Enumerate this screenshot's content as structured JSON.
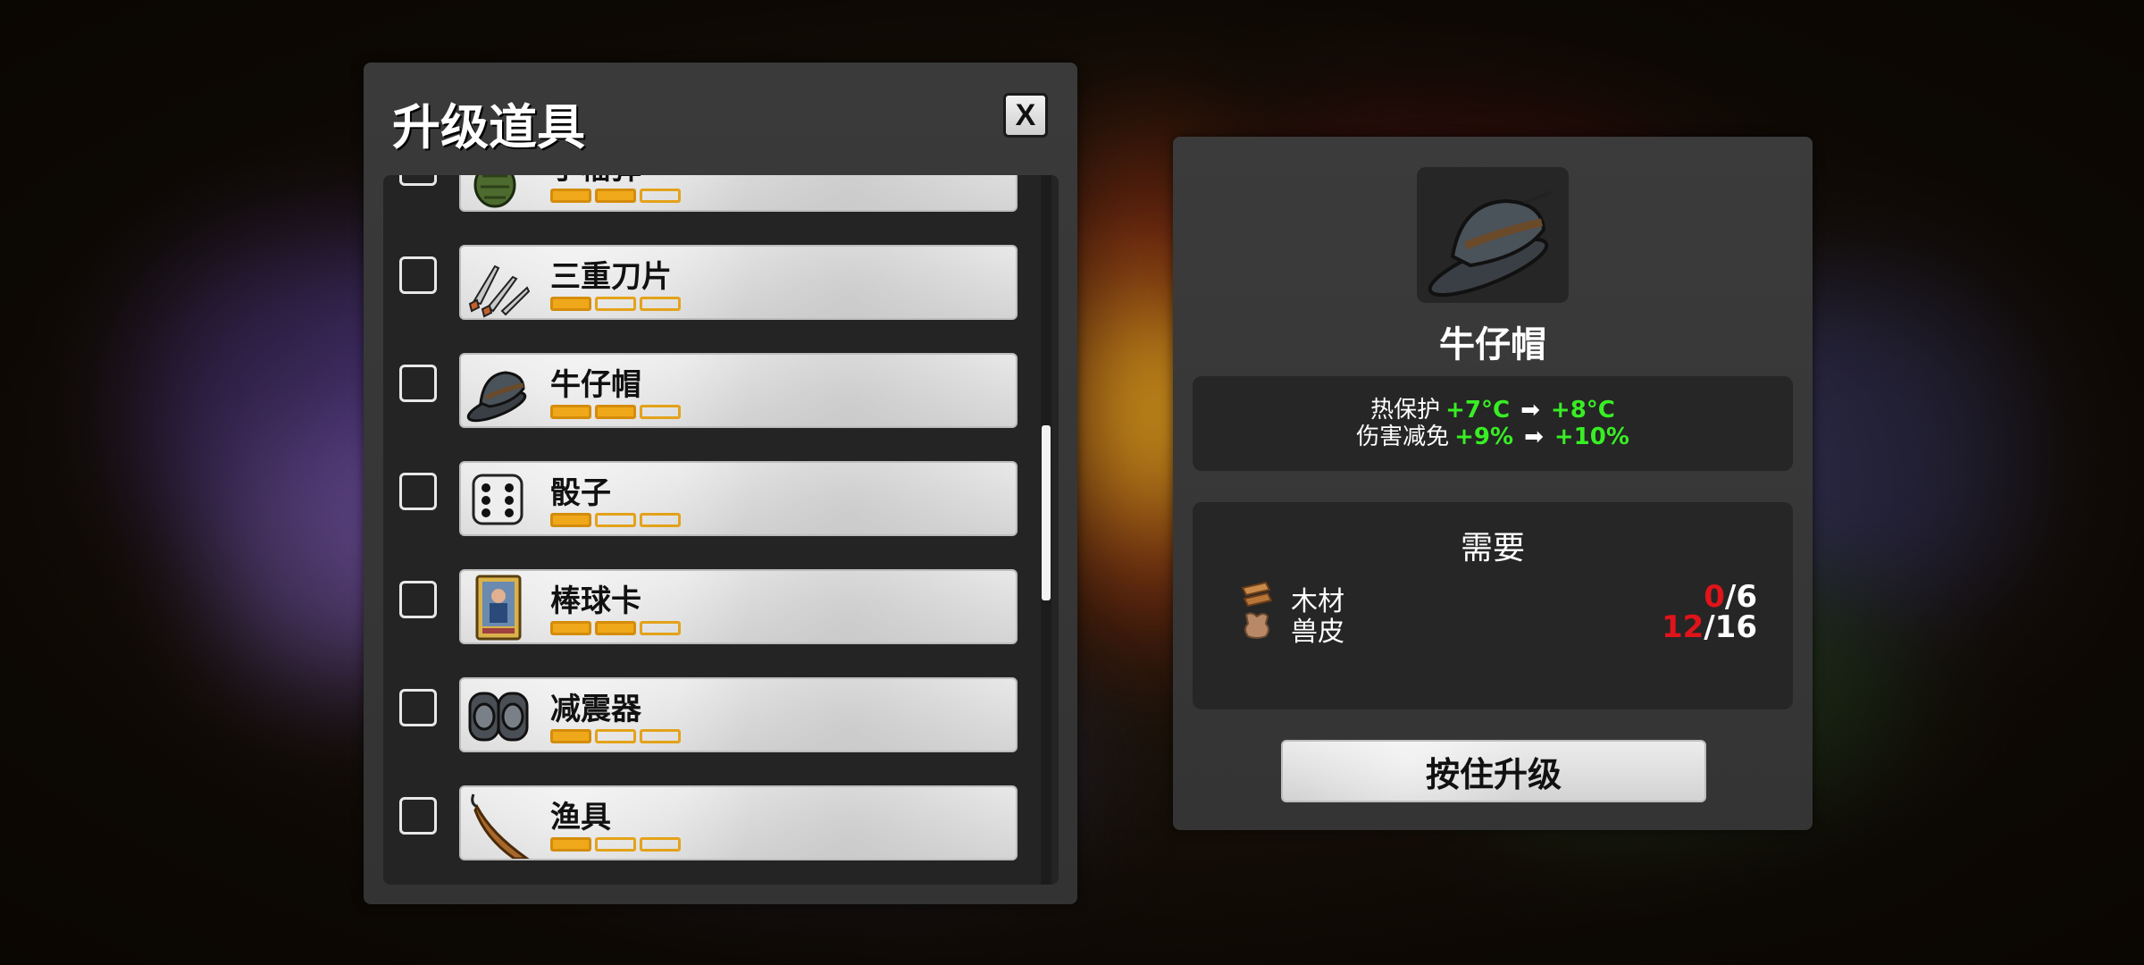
{
  "upgrade_panel": {
    "title": "升级道具",
    "close_label": "X",
    "items": [
      {
        "name": "手榴弹",
        "level": 2,
        "max_level": 3,
        "icon": "grenade-icon"
      },
      {
        "name": "三重刀片",
        "level": 1,
        "max_level": 3,
        "icon": "knives-icon"
      },
      {
        "name": "牛仔帽",
        "level": 2,
        "max_level": 3,
        "icon": "cowboy-hat-icon"
      },
      {
        "name": "骰子",
        "level": 1,
        "max_level": 3,
        "icon": "dice-icon"
      },
      {
        "name": "棒球卡",
        "level": 2,
        "max_level": 3,
        "icon": "baseball-card-icon"
      },
      {
        "name": "减震器",
        "level": 1,
        "max_level": 3,
        "icon": "knee-pads-icon"
      },
      {
        "name": "渔具",
        "level": 1,
        "max_level": 3,
        "icon": "fishing-rod-icon"
      }
    ]
  },
  "detail": {
    "icon": "cowboy-hat-icon",
    "name": "牛仔帽",
    "stats": [
      {
        "label": "热保护",
        "from": "+7°C",
        "to": "+8°C"
      },
      {
        "label": "伤害减免",
        "from": "+9%",
        "to": "+10%"
      }
    ],
    "requirements_title": "需要",
    "requirements": [
      {
        "name": "木材",
        "icon": "wood-icon",
        "have": "0",
        "need": "/6"
      },
      {
        "name": "兽皮",
        "icon": "hide-icon",
        "have": "12",
        "need": "/16"
      }
    ],
    "upgrade_button": "按住升级"
  },
  "colors": {
    "stat_green": "#38ee24",
    "insufficient_red": "#e0141a",
    "level_pip_orange": "#f0a81b"
  }
}
